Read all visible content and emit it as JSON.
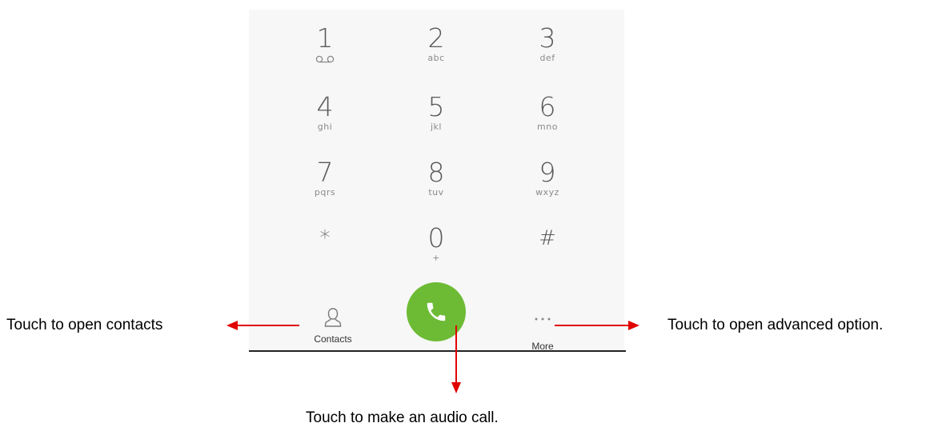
{
  "keypad": {
    "keys": [
      {
        "digit": "1",
        "letters": ""
      },
      {
        "digit": "2",
        "letters": "abc"
      },
      {
        "digit": "3",
        "letters": "def"
      },
      {
        "digit": "4",
        "letters": "ghi"
      },
      {
        "digit": "5",
        "letters": "jkl"
      },
      {
        "digit": "6",
        "letters": "mno"
      },
      {
        "digit": "7",
        "letters": "pqrs"
      },
      {
        "digit": "8",
        "letters": "tuv"
      },
      {
        "digit": "9",
        "letters": "wxyz"
      },
      {
        "digit": "*",
        "letters": ""
      },
      {
        "digit": "0",
        "letters": "+"
      },
      {
        "digit": "#",
        "letters": ""
      }
    ],
    "voicemail_icon": "voicemail-icon"
  },
  "bottom_bar": {
    "contacts_label": "Contacts",
    "contacts_icon": "person-icon",
    "call_icon": "phone-icon",
    "more_label": "More",
    "more_icon": "more-dots-icon"
  },
  "callouts": {
    "contacts": "Touch to open contacts",
    "more": "Touch to open advanced option.",
    "call": "Touch to make an audio call."
  },
  "colors": {
    "call_button": "#6dbb35",
    "arrow": "#e00000",
    "panel_background": "#f7f7f7"
  }
}
